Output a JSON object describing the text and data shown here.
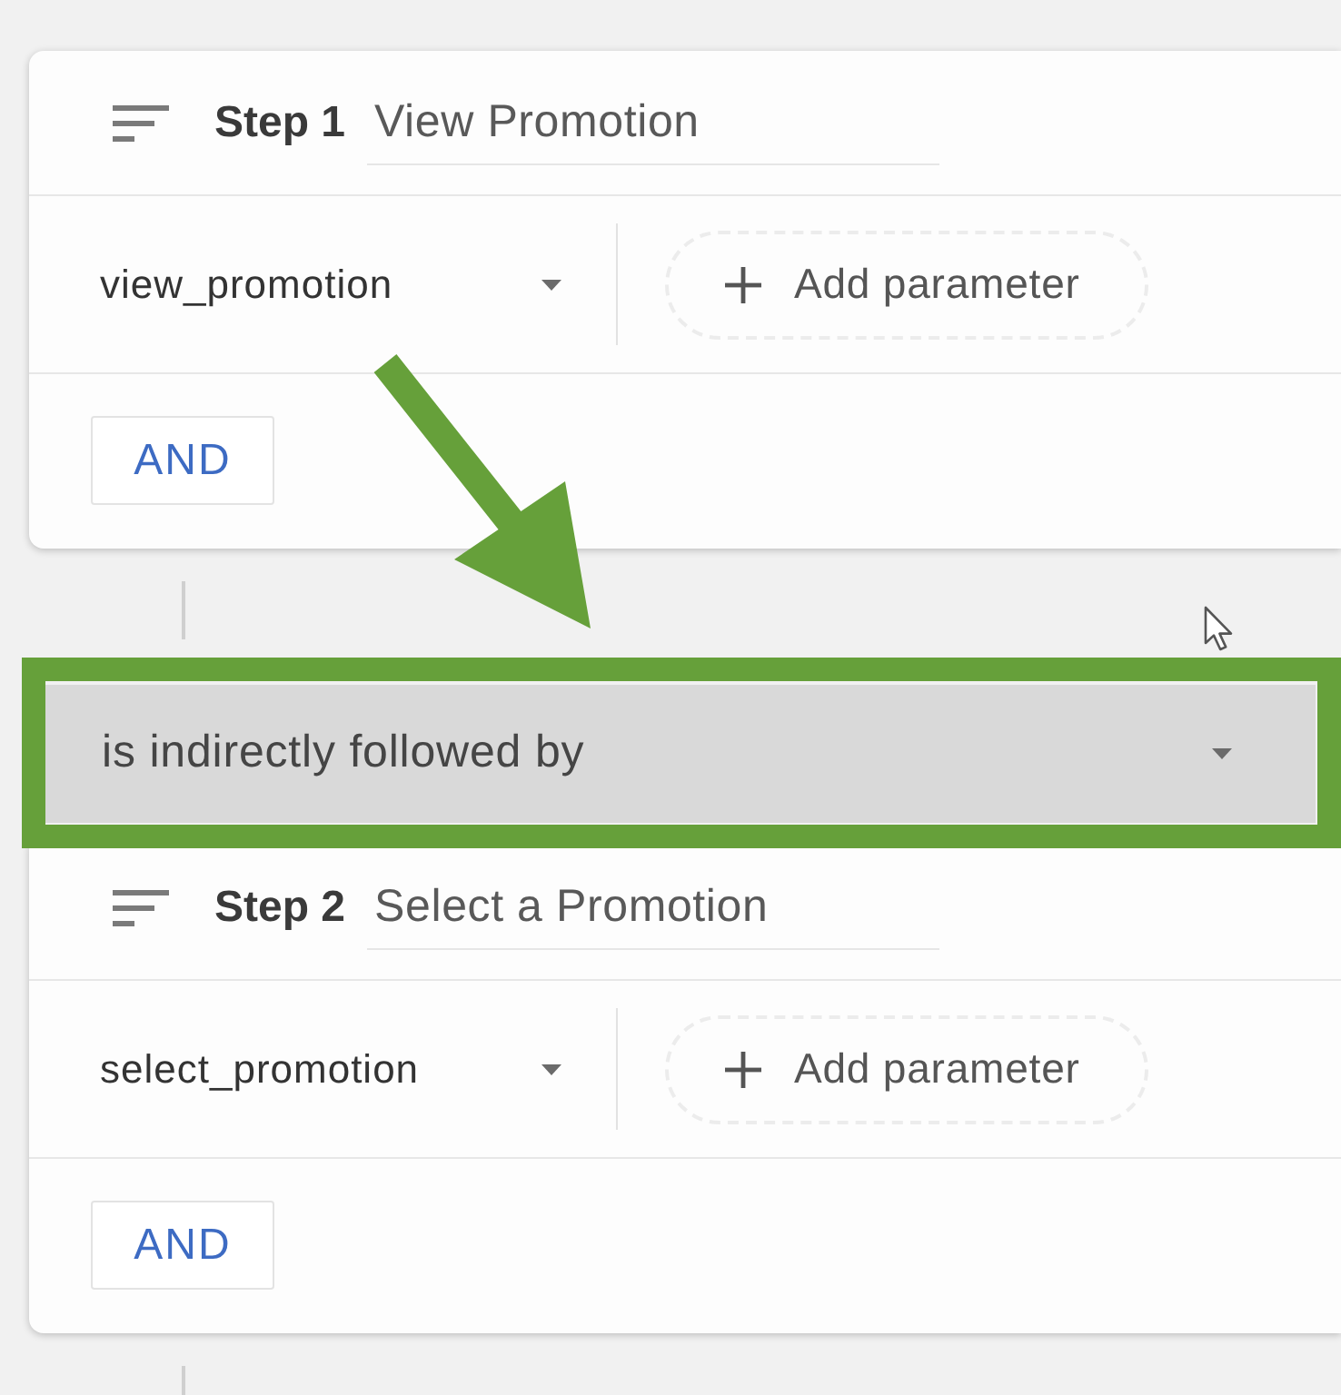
{
  "sequence": [
    {
      "kind": "step",
      "label": "Step 1",
      "name": "View Promotion",
      "event": "view_promotion",
      "add_parameter": "Add parameter",
      "operator": "AND"
    },
    {
      "kind": "condition",
      "value": "is indirectly followed by",
      "highlighted": true
    },
    {
      "kind": "step",
      "label": "Step 2",
      "name": "Select a Promotion",
      "event": "select_promotion",
      "add_parameter": "Add parameter",
      "operator": "AND"
    }
  ]
}
